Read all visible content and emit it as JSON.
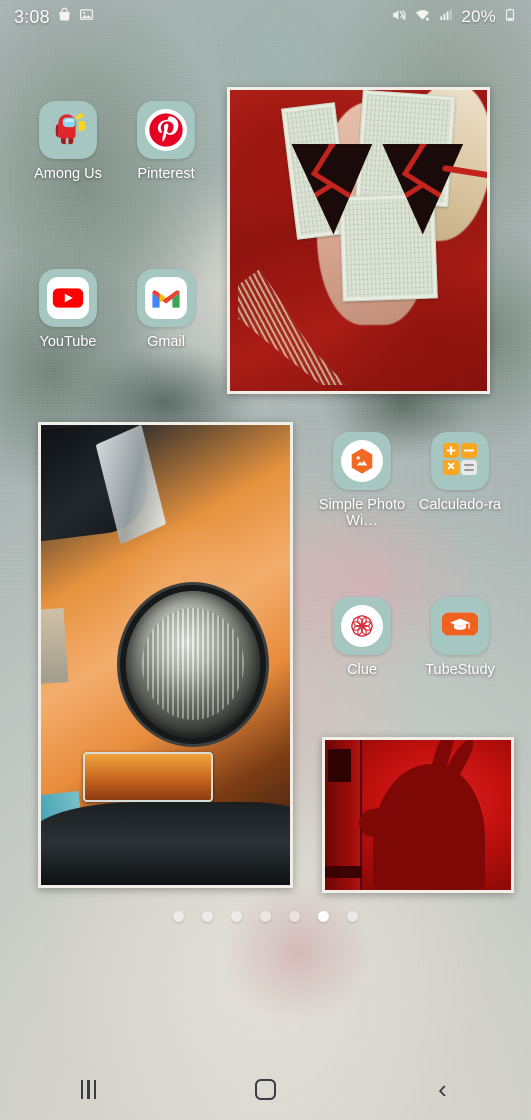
{
  "device": {
    "platform": "android-home-screen",
    "accent_tile_color": "#a6c6c1",
    "label_color": "#ffffff"
  },
  "status_bar": {
    "time": "3:08",
    "left_icons": [
      "shopping-bag-icon",
      "gallery-image-icon"
    ],
    "right_icons": [
      "mute-volume-icon",
      "wifi-plus-icon",
      "cellular-signal-icon"
    ],
    "battery_percent": "20%",
    "battery_icon": "battery-low-icon"
  },
  "apps": [
    {
      "name": "Among Us",
      "icon": "among-us-icon",
      "col": 0,
      "row": 0
    },
    {
      "name": "Pinterest",
      "icon": "pinterest-icon",
      "col": 1,
      "row": 0
    },
    {
      "name": "YouTube",
      "icon": "youtube-icon",
      "col": 0,
      "row": 1
    },
    {
      "name": "Gmail",
      "icon": "gmail-icon",
      "col": 1,
      "row": 1
    },
    {
      "name": "Simple Photo Wi…",
      "icon": "simple-photo-widget-icon",
      "col": 2,
      "row": 2
    },
    {
      "name": "Calculado-ra",
      "icon": "calculator-icon",
      "col": 3,
      "row": 2
    },
    {
      "name": "Clue",
      "icon": "clue-icon",
      "col": 2,
      "row": 3
    },
    {
      "name": "TubeStudy",
      "icon": "tubestudy-icon",
      "col": 3,
      "row": 3
    }
  ],
  "widgets": [
    {
      "id": "money",
      "type": "photo-widget",
      "description": "Person in red jacket wearing red heart-shaped sunglasses with dollar bills on face"
    },
    {
      "id": "car",
      "type": "photo-widget",
      "description": "Close-up of orange vintage Volkswagen Beetle headlight"
    },
    {
      "id": "red",
      "type": "photo-widget",
      "description": "Red-toned photo of a horned silhouette shadow on a wall"
    }
  ],
  "page_indicator": {
    "total": 7,
    "active_index": 5
  },
  "nav_bar": {
    "recents_label": "Recents",
    "home_label": "Home",
    "back_label": "Back",
    "icons": [
      "recents-icon",
      "home-icon",
      "back-icon"
    ]
  },
  "wallpaper": {
    "description": "Desaturated teal-grey close-up of a classical marble statue's face and shoulder with film grain"
  }
}
